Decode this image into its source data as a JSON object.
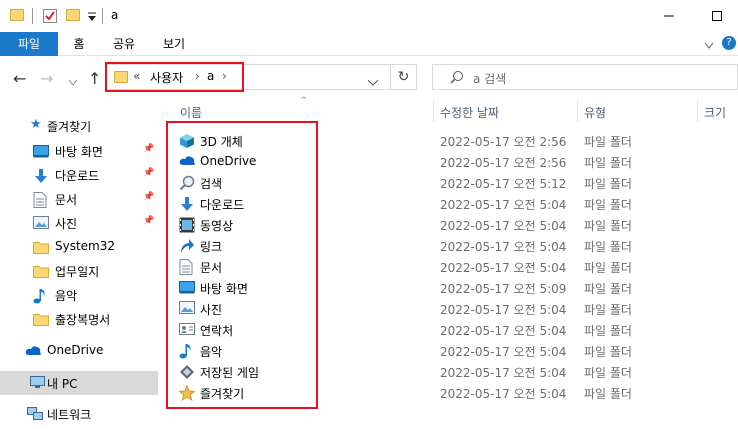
{
  "window": {
    "title": "a"
  },
  "ribbon": {
    "tabs": [
      "파일",
      "홈",
      "공유",
      "보기"
    ]
  },
  "address": {
    "overflow": "«",
    "crumbs": [
      "사용자",
      "a"
    ]
  },
  "search": {
    "placeholder": "a 검색"
  },
  "sidebar": {
    "quick_access": "즐겨찾기",
    "items": [
      {
        "label": "바탕 화면",
        "icon": "desktop-icon",
        "pinned": true
      },
      {
        "label": "다운로드",
        "icon": "download-icon",
        "pinned": true
      },
      {
        "label": "문서",
        "icon": "document-icon",
        "pinned": true
      },
      {
        "label": "사진",
        "icon": "picture-icon",
        "pinned": true
      },
      {
        "label": "System32",
        "icon": "folder-icon",
        "pinned": false
      },
      {
        "label": "업무일지",
        "icon": "folder-icon",
        "pinned": false
      },
      {
        "label": "음악",
        "icon": "music-icon",
        "pinned": false
      },
      {
        "label": "출장복명서",
        "icon": "folder-icon",
        "pinned": false
      }
    ],
    "onedrive": "OneDrive",
    "this_pc": "내 PC",
    "network": "네트워크"
  },
  "columns": {
    "name": "이름",
    "modified": "수정한 날짜",
    "type": "유형",
    "size": "크기"
  },
  "files": [
    {
      "name": "3D 개체",
      "modified": "2022-05-17 오전 2:56",
      "type": "파일 폴더",
      "icon": "3d-objects-icon"
    },
    {
      "name": "OneDrive",
      "modified": "2022-05-17 오전 2:56",
      "type": "파일 폴더",
      "icon": "onedrive-icon"
    },
    {
      "name": "검색",
      "modified": "2022-05-17 오전 5:12",
      "type": "파일 폴더",
      "icon": "search-icon"
    },
    {
      "name": "다운로드",
      "modified": "2022-05-17 오전 5:04",
      "type": "파일 폴더",
      "icon": "download-icon"
    },
    {
      "name": "동영상",
      "modified": "2022-05-17 오전 5:04",
      "type": "파일 폴더",
      "icon": "video-icon"
    },
    {
      "name": "링크",
      "modified": "2022-05-17 오전 5:04",
      "type": "파일 폴더",
      "icon": "link-icon"
    },
    {
      "name": "문서",
      "modified": "2022-05-17 오전 5:04",
      "type": "파일 폴더",
      "icon": "document-icon"
    },
    {
      "name": "바탕 화면",
      "modified": "2022-05-17 오전 5:09",
      "type": "파일 폴더",
      "icon": "desktop-icon"
    },
    {
      "name": "사진",
      "modified": "2022-05-17 오전 5:04",
      "type": "파일 폴더",
      "icon": "picture-icon"
    },
    {
      "name": "연락처",
      "modified": "2022-05-17 오전 5:04",
      "type": "파일 폴더",
      "icon": "contacts-icon"
    },
    {
      "name": "음악",
      "modified": "2022-05-17 오전 5:04",
      "type": "파일 폴더",
      "icon": "music-icon"
    },
    {
      "name": "저장된 게임",
      "modified": "2022-05-17 오전 5:04",
      "type": "파일 폴더",
      "icon": "saved-games-icon"
    },
    {
      "name": "즐겨찾기",
      "modified": "2022-05-17 오전 5:04",
      "type": "파일 폴더",
      "icon": "favorites-icon"
    }
  ],
  "colors": {
    "accent": "#1979ca",
    "highlight": "#e81123",
    "folder": "#f8d775"
  }
}
